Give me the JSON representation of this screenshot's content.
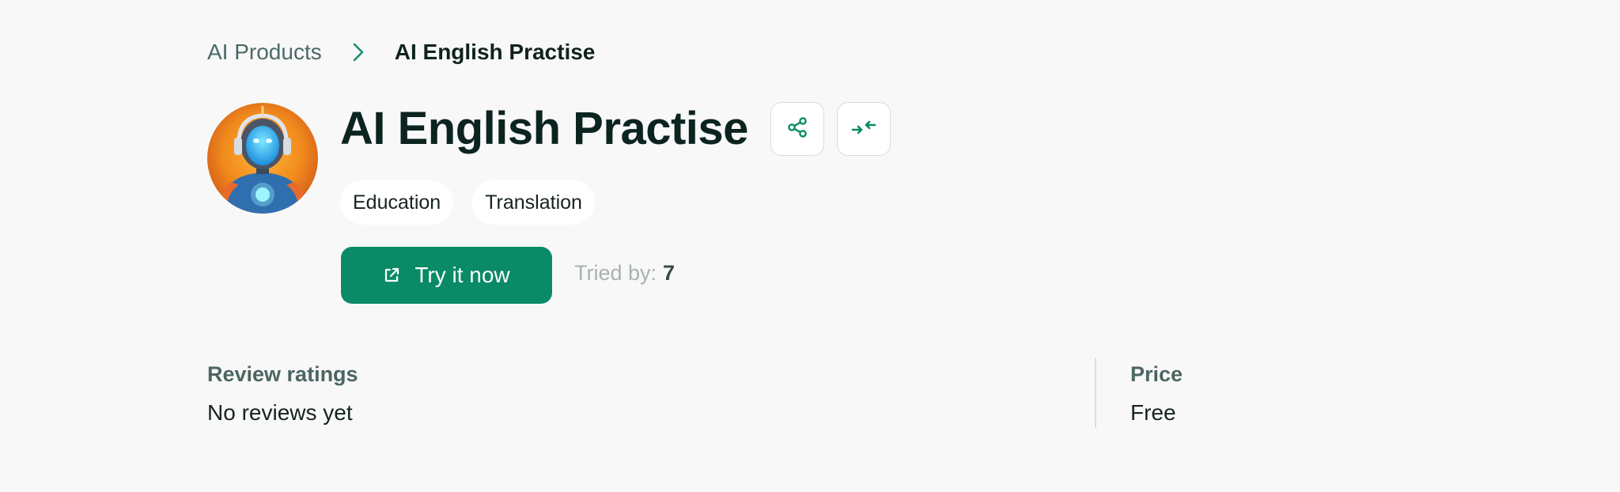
{
  "breadcrumb": {
    "parent": "AI Products",
    "current": "AI English Practise"
  },
  "product": {
    "title": "AI English Practise",
    "tags": [
      "Education",
      "Translation"
    ],
    "cta_label": "Try it now",
    "tried_label": "Tried by:",
    "tried_count": "7"
  },
  "info": {
    "ratings_label": "Review ratings",
    "ratings_value": "No reviews yet",
    "price_label": "Price",
    "price_value": "Free"
  },
  "icons": {
    "breadcrumb_separator": "chevron-right-icon",
    "share": "share-icon",
    "compare": "compress-arrows-icon",
    "cta": "external-link-icon"
  },
  "colors": {
    "accent": "#0a8a66",
    "background": "#f8f8f8",
    "title": "#0c2420",
    "muted": "#a9b2b0"
  }
}
